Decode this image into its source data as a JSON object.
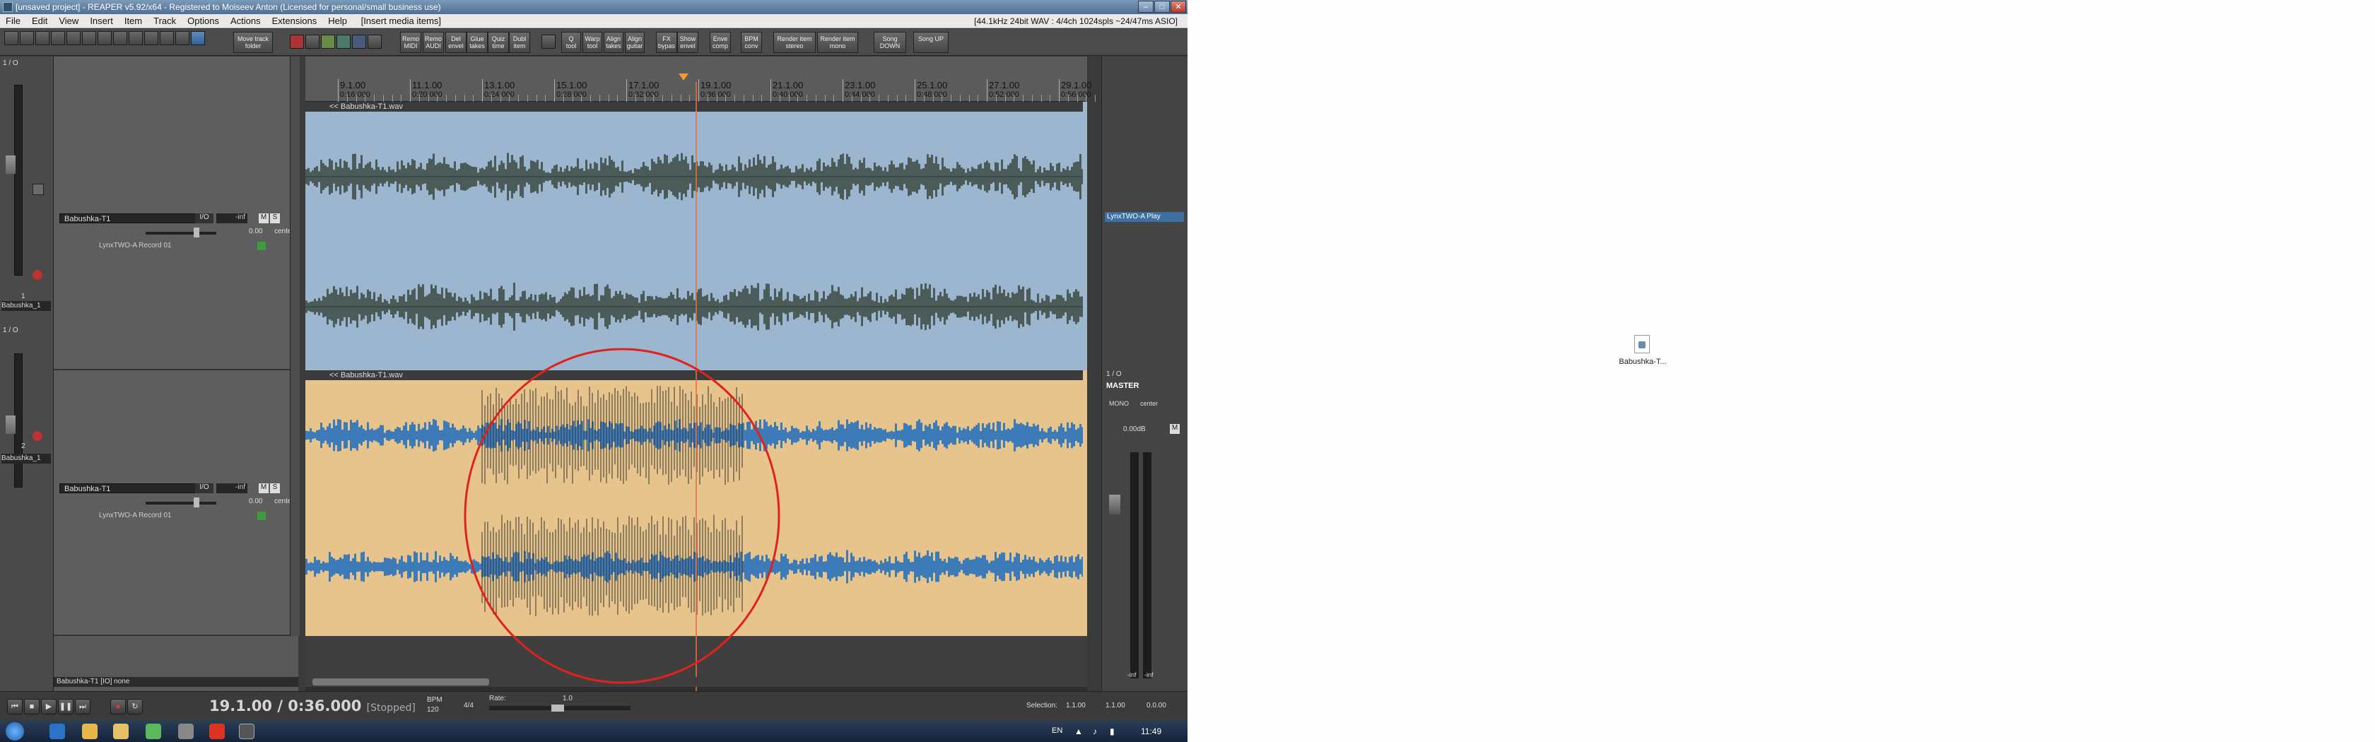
{
  "window": {
    "title": "[unsaved project] - REAPER v5.92/x64 - Registered to Moiseev Anton (Licensed for personal/small business use)",
    "status_right": "[44.1kHz 24bit WAV : 4/4ch 1024spls ~24/47ms ASIO]"
  },
  "menu": [
    "File",
    "Edit",
    "View",
    "Insert",
    "Item",
    "Track",
    "Options",
    "Actions",
    "Extensions",
    "Help"
  ],
  "menu_status": "[Insert media items]",
  "toolbar": {
    "buttons": [
      {
        "label": "Move track\nfolder"
      },
      {
        "label": "Remo\nMIDI"
      },
      {
        "label": "Remo\nAUDI"
      },
      {
        "label": "Del\nenvel"
      },
      {
        "label": "Glue\ntakes"
      },
      {
        "label": "Quiz\ntime"
      },
      {
        "label": "Dubl\nitem"
      },
      {
        "label": "Q\ntool"
      },
      {
        "label": "Warp\ntool"
      },
      {
        "label": "Align\ntakes"
      },
      {
        "label": "Align\nguitar"
      },
      {
        "label": "FX\nbypas"
      },
      {
        "label": "Show\nenvel"
      },
      {
        "label": "Enve\ncomp"
      },
      {
        "label": "BPM\nconv"
      },
      {
        "label": "Render item\nstereo"
      },
      {
        "label": "Render item\nmono"
      },
      {
        "label": "Song\nDOWN"
      },
      {
        "label": "Song UP"
      }
    ]
  },
  "ruler": {
    "markers": [
      {
        "bar": "9.1.00",
        "time": "0:16.000"
      },
      {
        "bar": "11.1.00",
        "time": "0:20.000"
      },
      {
        "bar": "13.1.00",
        "time": "0:24.000"
      },
      {
        "bar": "15.1.00",
        "time": "0:28.000"
      },
      {
        "bar": "17.1.00",
        "time": "0:32.000"
      },
      {
        "bar": "19.1.00",
        "time": "0:36.000"
      },
      {
        "bar": "21.1.00",
        "time": "0:40.000"
      },
      {
        "bar": "23.1.00",
        "time": "0:44.000"
      },
      {
        "bar": "25.1.00",
        "time": "0:48.000"
      },
      {
        "bar": "27.1.00",
        "time": "0:52.000"
      },
      {
        "bar": "29.1.00",
        "time": "0:56.000"
      }
    ]
  },
  "tracks": [
    {
      "name": "Babushka-T1",
      "io": "I/O",
      "vol": "-inf",
      "vol2": "0.00",
      "pan": "center",
      "input": "LynxTWO-A Record 01",
      "item": "<< Babushka-T1.wav",
      "strip_num": "1",
      "strip_label": "Babushka_1",
      "strip_io": "1 / O"
    },
    {
      "name": "Babushka-T1",
      "io": "I/O",
      "vol": "-inf",
      "vol2": "0.00",
      "pan": "center",
      "input": "LynxTWO-A Record 01",
      "item": "<< Babushka-T1.wav",
      "strip_num": "2",
      "strip_label": "Babushka_1",
      "strip_io": "1 / O"
    }
  ],
  "mixer": {
    "output_label": "LynxTWO-A Play",
    "master_label": "MASTER",
    "io": "1 / O",
    "db": "0.00dB",
    "mono": "MONO",
    "center": "center",
    "meter_l": "-inf",
    "meter_r": "-inf"
  },
  "status_bar": "Babushka-T1 [IO] none",
  "transport": {
    "time": "19.1.00 / 0:36.000",
    "state": "[Stopped]",
    "bpm_label": "BPM",
    "bpm": "120",
    "sig": "4/4",
    "rate_label": "Rate:",
    "rate": "1.0",
    "selection_label": "Selection:",
    "sel_start": "1.1.00",
    "sel_end": "1.1.00",
    "sel_len": "0.0.00"
  },
  "taskbar": {
    "lang": "EN",
    "clock": "11:49"
  },
  "desktop": {
    "file_label": "Babushka-T..."
  },
  "colors": {
    "track1": "#9db6cf",
    "track2": "#e8c48d",
    "wave": "#4b5b57",
    "wave2": "#3d7ab8",
    "circle": "#e0211c",
    "cursor": "#e07045"
  }
}
